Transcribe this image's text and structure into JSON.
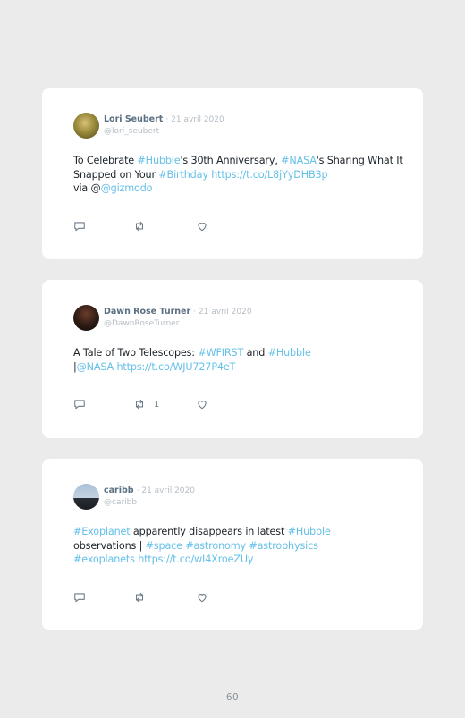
{
  "tweets": [
    {
      "author": "Lori Seubert",
      "date": "· 21 avril 2020",
      "handle": "@lori_seubert",
      "text_parts": [
        "To Celebrate ",
        "#Hubble",
        "'s 30th Anniversary, ",
        "#NASA",
        "'s Sharing What It Snapped on Your ",
        "#Birthday",
        " ",
        "https://t.co/L8jYyDHB3p",
        " via @",
        "@gizmodo"
      ],
      "retweet_count": ""
    },
    {
      "author": "Dawn Rose Turner",
      "date": "· 21 avril 2020",
      "handle": "@DawnRoseTurner",
      "text_parts": [
        "A Tale of Two Telescopes: ",
        "#WFIRST",
        " and ",
        "#Hubble",
        " |",
        "@NASA",
        " ",
        "https://t.co/WJU727P4eT"
      ],
      "retweet_count": "1"
    },
    {
      "author": "caribb",
      "date": "· 21 avril 2020",
      "handle": "@caribb",
      "text_parts": [
        "#Exoplanet",
        " apparently disappears in latest ",
        "#Hubble",
        " observations | ",
        "#space",
        " ",
        "#astronomy",
        " ",
        "#astrophysics",
        " ",
        "#exoplanets",
        " ",
        "https://t.co/wI4XroeZUy"
      ],
      "retweet_count": ""
    }
  ],
  "icons": {
    "reply": "reply-icon",
    "retweet": "retweet-icon",
    "like": "heart-icon"
  },
  "colors": {
    "background": "#ebebeb",
    "card": "#ffffff",
    "link": "#66c0e8",
    "name": "#5a6f82",
    "muted": "#b6bec5"
  },
  "page_number": "60"
}
